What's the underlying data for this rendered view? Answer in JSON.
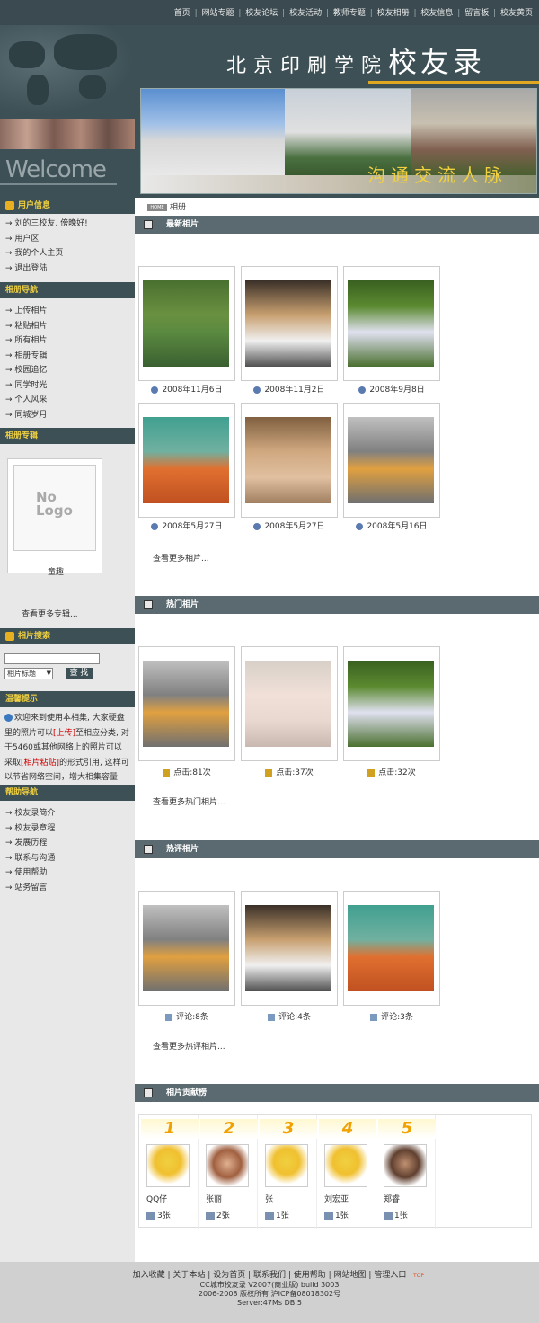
{
  "topnav": [
    "首页",
    "网站专题",
    "校友论坛",
    "校友活动",
    "教师专题",
    "校友相册",
    "校友信息",
    "留言板",
    "校友黄页"
  ],
  "brand": {
    "small": "北京印刷学院",
    "big": "校友录"
  },
  "welcome": "Welcome",
  "slogan": "沟通交流人脉",
  "breadcrumb": {
    "home": "HOME",
    "current": "相册"
  },
  "sidebar": {
    "user_info": {
      "title": "用户信息",
      "items": [
        "刘的三校友, 傍晚好!",
        "用户区",
        "我的个人主页",
        "退出登陆"
      ]
    },
    "album_nav": {
      "title": "相册导航",
      "items": [
        "上传相片",
        "粘贴相片",
        "所有相片",
        "相册专辑",
        "校园追忆",
        "同学时光",
        "个人风采",
        "同城岁月"
      ]
    },
    "album_special": {
      "title": "相册专辑",
      "logo_text": "No Logo",
      "album_name": "童趣",
      "more": "查看更多专辑..."
    },
    "search": {
      "title": "相片搜索",
      "select_value": "相片标题",
      "button": "查 找"
    },
    "tips": {
      "title": "温馨提示",
      "text_before": "欢迎来到使用本相集, 大家硬盘里的照片可以",
      "link_upload": "[上传]",
      "text_mid": "至相应分类, 对于5460或其他网络上的照片可以采取",
      "link_paste": "[相片粘贴]",
      "text_after": "的形式引用, 这样可以节省网络空间，增大相集容量"
    },
    "help": {
      "title": "帮助导航",
      "items": [
        "校友录简介",
        "校友录章程",
        "发展历程",
        "联系与沟通",
        "使用帮助",
        "站务留言"
      ]
    }
  },
  "latest": {
    "title": "最新相片",
    "dates": [
      "2008年11月6日",
      "2008年11月2日",
      "2008年9月8日",
      "2008年5月27日",
      "2008年5月27日",
      "2008年5月16日"
    ],
    "more": "查看更多相片..."
  },
  "hot": {
    "title": "热门相片",
    "clicks": [
      "点击:81次",
      "点击:37次",
      "点击:32次"
    ],
    "more": "查看更多热门相片..."
  },
  "commented": {
    "title": "热评相片",
    "comments": [
      "评论:8条",
      "评论:4条",
      "评论:3条"
    ],
    "more": "查看更多热评相片..."
  },
  "ranking": {
    "title": "相片贡献榜",
    "entries": [
      {
        "rank": "1",
        "name": "QQ仔",
        "count": "3张"
      },
      {
        "rank": "2",
        "name": "张丽",
        "count": "2张"
      },
      {
        "rank": "3",
        "name": "张",
        "count": "1张"
      },
      {
        "rank": "4",
        "name": "刘宏亚",
        "count": "1张"
      },
      {
        "rank": "5",
        "name": "郑睿",
        "count": "1张"
      }
    ]
  },
  "footer": {
    "links": [
      "加入收藏",
      "关于本站",
      "设为首页",
      "联系我们",
      "使用帮助",
      "网站地图",
      "管理入口"
    ],
    "line1": "CC城市校友录 V2007(商业版) build 3003",
    "line2": "2006-2008 版权所有 沪ICP备08018302号",
    "line3": "Server:47Ms  DB:5",
    "top": "TOP"
  },
  "colors": {
    "header": "#3d5055",
    "bar": "#5a6a70",
    "accent": "#f0d040"
  }
}
